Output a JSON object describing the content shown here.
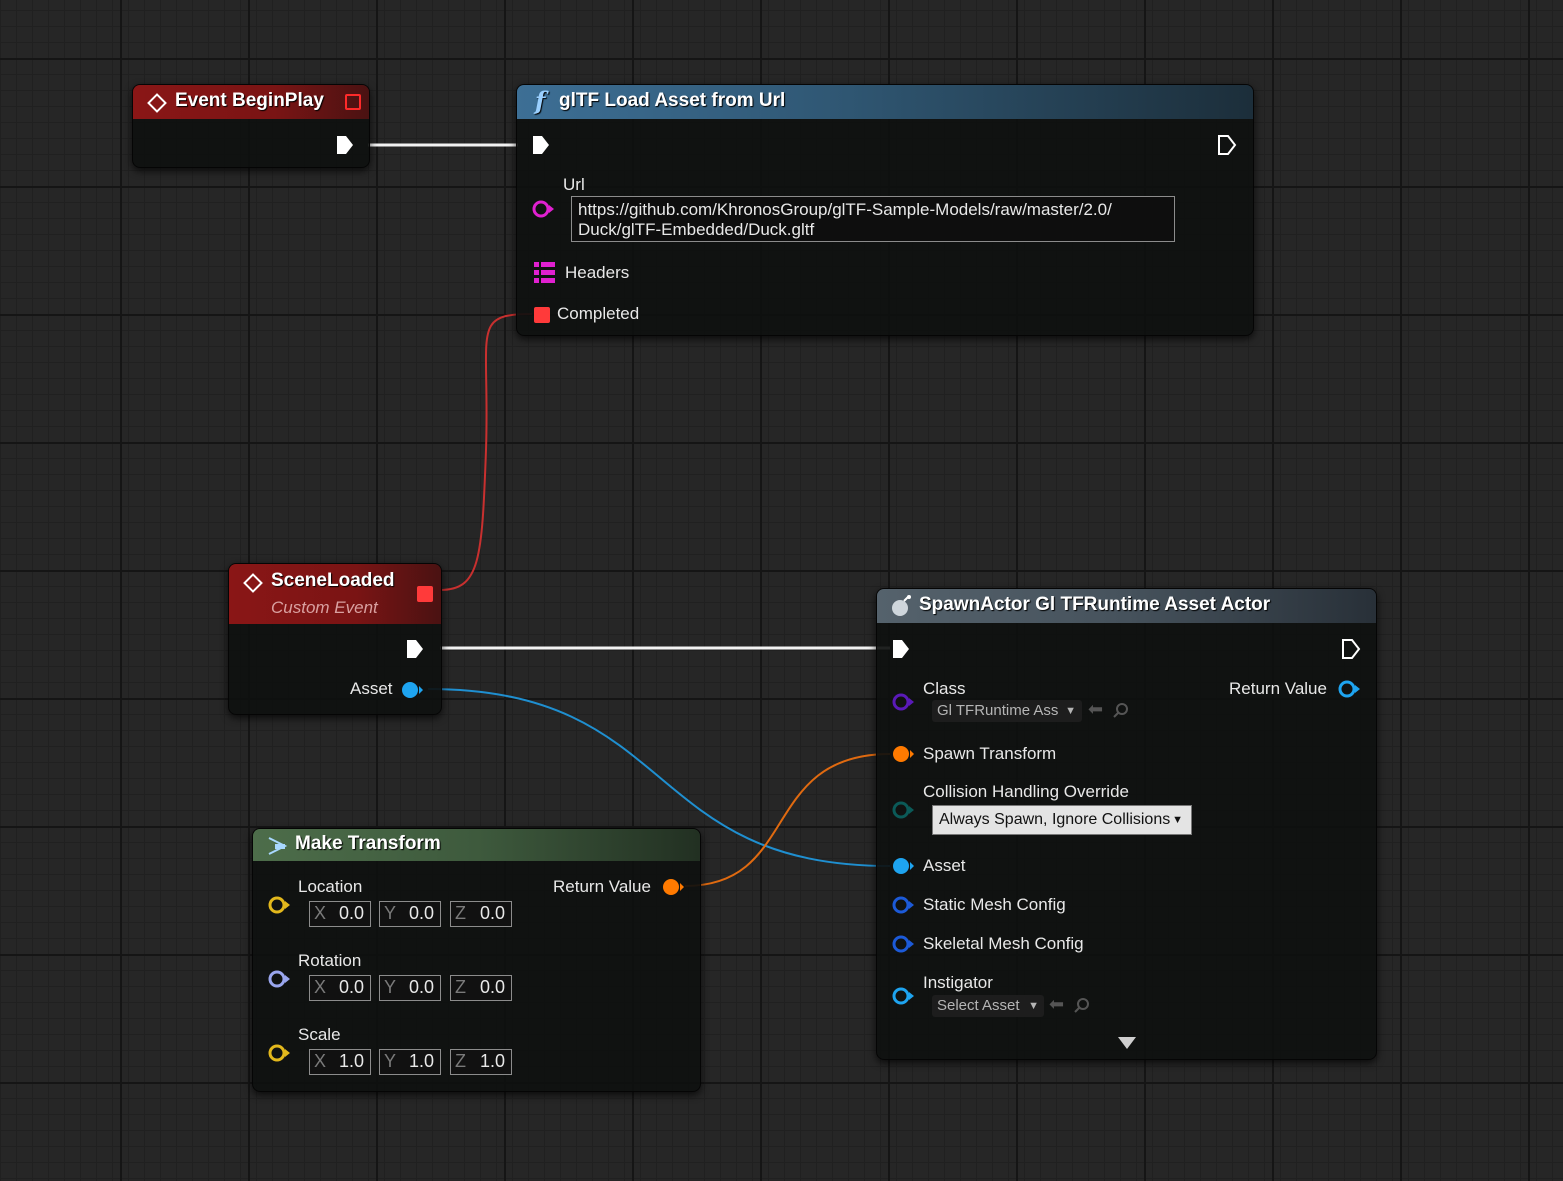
{
  "nodes": {
    "begin_play": {
      "title": "Event BeginPlay"
    },
    "load_asset": {
      "title": "glTF Load Asset from Url",
      "url_label": "Url",
      "url_value_line1": "https://github.com/KhronosGroup/glTF-Sample-Models/raw/master/2.0/",
      "url_value_line2": "Duck/glTF-Embedded/Duck.gltf",
      "headers_label": "Headers",
      "completed_label": "Completed"
    },
    "scene_loaded": {
      "title": "SceneLoaded",
      "subtitle": "Custom Event",
      "asset_label": "Asset"
    },
    "spawn_actor": {
      "title": "SpawnActor Gl TFRuntime Asset Actor",
      "class_label": "Class",
      "class_value": "Gl TFRuntime Ass",
      "return_label": "Return Value",
      "spawn_transform_label": "Spawn Transform",
      "collision_label": "Collision Handling Override",
      "collision_value": "Always Spawn, Ignore Collisions",
      "asset_label": "Asset",
      "static_mesh_label": "Static Mesh Config",
      "skeletal_mesh_label": "Skeletal Mesh Config",
      "instigator_label": "Instigator",
      "instigator_value": "Select Asset"
    },
    "make_transform": {
      "title": "Make Transform",
      "return_label": "Return Value",
      "location": {
        "label": "Location",
        "x": "0.0",
        "y": "0.0",
        "z": "0.0"
      },
      "rotation": {
        "label": "Rotation",
        "x": "0.0",
        "y": "0.0",
        "z": "0.0"
      },
      "scale": {
        "label": "Scale",
        "x": "1.0",
        "y": "1.0",
        "z": "1.0"
      },
      "axis_x": "X",
      "axis_y": "Y",
      "axis_z": "Z"
    }
  },
  "colors": {
    "exec_wire": "#ffffff",
    "delegate_red": "#ff3a3a",
    "object_blue": "#1ea4f0",
    "struct_orange": "#ff7a00",
    "string_magenta": "#e020d0",
    "vector_yellow": "#e3b81c",
    "rotator_lavender": "#9aa6ee",
    "class_purple": "#5a1ab8",
    "enum_teal": "#0b5a58",
    "struct_darkblue": "#1c5ad8"
  }
}
